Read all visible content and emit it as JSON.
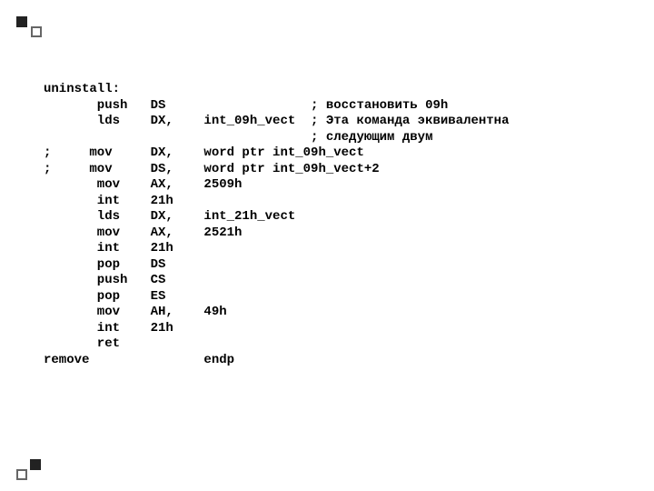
{
  "lines": [
    {
      "col1": "uninstall:",
      "col2": "",
      "col3": "",
      "col4": ""
    },
    {
      "col1": "       push",
      "col2": "DS",
      "col3": "",
      "col4": "; восстановить 09h"
    },
    {
      "col1": "       lds",
      "col2": "DX,",
      "col3": "int_09h_vect",
      "col4": "; Эта команда эквивалентна"
    },
    {
      "col1": "",
      "col2": "",
      "col3": "",
      "col4": "; следующим двум"
    },
    {
      "col1": ";     mov",
      "col2": "DX,",
      "col3": "word ptr int_09h_vect",
      "col4": ""
    },
    {
      "col1": ";     mov",
      "col2": "DS,",
      "col3": "word ptr int_09h_vect+2",
      "col4": ""
    },
    {
      "col1": "       mov",
      "col2": "AX,",
      "col3": "2509h",
      "col4": ""
    },
    {
      "col1": "       int",
      "col2": "21h",
      "col3": "",
      "col4": ""
    },
    {
      "col1": "       lds",
      "col2": "DX,",
      "col3": "int_21h_vect",
      "col4": ""
    },
    {
      "col1": "       mov",
      "col2": "AX,",
      "col3": "2521h",
      "col4": ""
    },
    {
      "col1": "       int",
      "col2": "21h",
      "col3": "",
      "col4": ""
    },
    {
      "col1": "       pop",
      "col2": "DS",
      "col3": "",
      "col4": ""
    },
    {
      "col1": "       push",
      "col2": "CS",
      "col3": "",
      "col4": ""
    },
    {
      "col1": "       pop",
      "col2": "ES",
      "col3": "",
      "col4": ""
    },
    {
      "col1": "       mov",
      "col2": "AH,",
      "col3": "49h",
      "col4": ""
    },
    {
      "col1": "       int",
      "col2": "21h",
      "col3": "",
      "col4": ""
    },
    {
      "col1": "       ret",
      "col2": "",
      "col3": "",
      "col4": ""
    },
    {
      "col1": "remove",
      "col2": "",
      "col3": "endp",
      "col4": ""
    }
  ],
  "widths": {
    "c1": 14,
    "c2": 7,
    "c3_short": 14,
    "c3_wide": 29
  }
}
